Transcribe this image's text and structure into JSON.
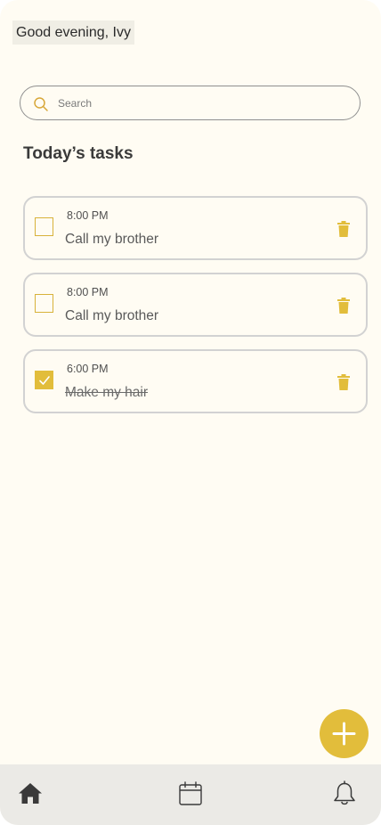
{
  "header": {
    "greeting": "Good evening, Ivy"
  },
  "search": {
    "placeholder": "Search",
    "value": ""
  },
  "section": {
    "title": "Today’s tasks"
  },
  "tasks": [
    {
      "time": "8:00 PM",
      "title": "Call my brother",
      "completed": false
    },
    {
      "time": "8:00 PM",
      "title": "Call my brother",
      "completed": false
    },
    {
      "time": "6:00 PM",
      "title": "Make my hair",
      "completed": true
    }
  ],
  "fab": {
    "icon": "plus-icon"
  },
  "tabbar": {
    "items": [
      {
        "icon": "home-icon"
      },
      {
        "icon": "calendar-icon"
      },
      {
        "icon": "bell-icon"
      }
    ]
  },
  "colors": {
    "accent": "#e2bd3b",
    "background": "#fffcf3",
    "card_border": "#d2d2d2",
    "tabbar": "#ebeae6"
  }
}
